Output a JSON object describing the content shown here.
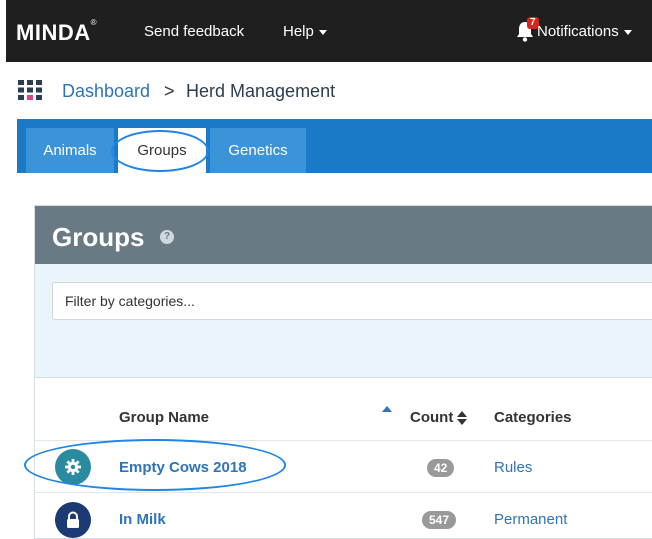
{
  "navbar": {
    "logo": "MINDA",
    "logo_mark": "®",
    "send_feedback": "Send feedback",
    "help": "Help",
    "notifications_count": "7",
    "notifications": "Notifications"
  },
  "breadcrumb": {
    "dashboard": "Dashboard",
    "separator": ">",
    "current": "Herd Management"
  },
  "tabs": [
    {
      "label": "Animals"
    },
    {
      "label": "Groups"
    },
    {
      "label": "Genetics"
    }
  ],
  "panel": {
    "title": "Groups",
    "help_glyph": "?",
    "filter_placeholder": "Filter by categories..."
  },
  "table": {
    "headers": {
      "name": "Group Name",
      "count": "Count",
      "categories": "Categories"
    },
    "rows": [
      {
        "name": "Empty Cows 2018",
        "count": "42",
        "category": "Rules",
        "icon": "gear-icon",
        "icon_color": "#2a8aa0"
      },
      {
        "name": "In Milk",
        "count": "547",
        "category": "Permanent",
        "icon": "lock-icon",
        "icon_color": "#1c3a73"
      }
    ]
  },
  "colors": {
    "navbar": "#1f1f1f",
    "tabbar": "#1b7ac7",
    "link": "#2f73b8",
    "highlight_ring": "#1f85e6"
  }
}
